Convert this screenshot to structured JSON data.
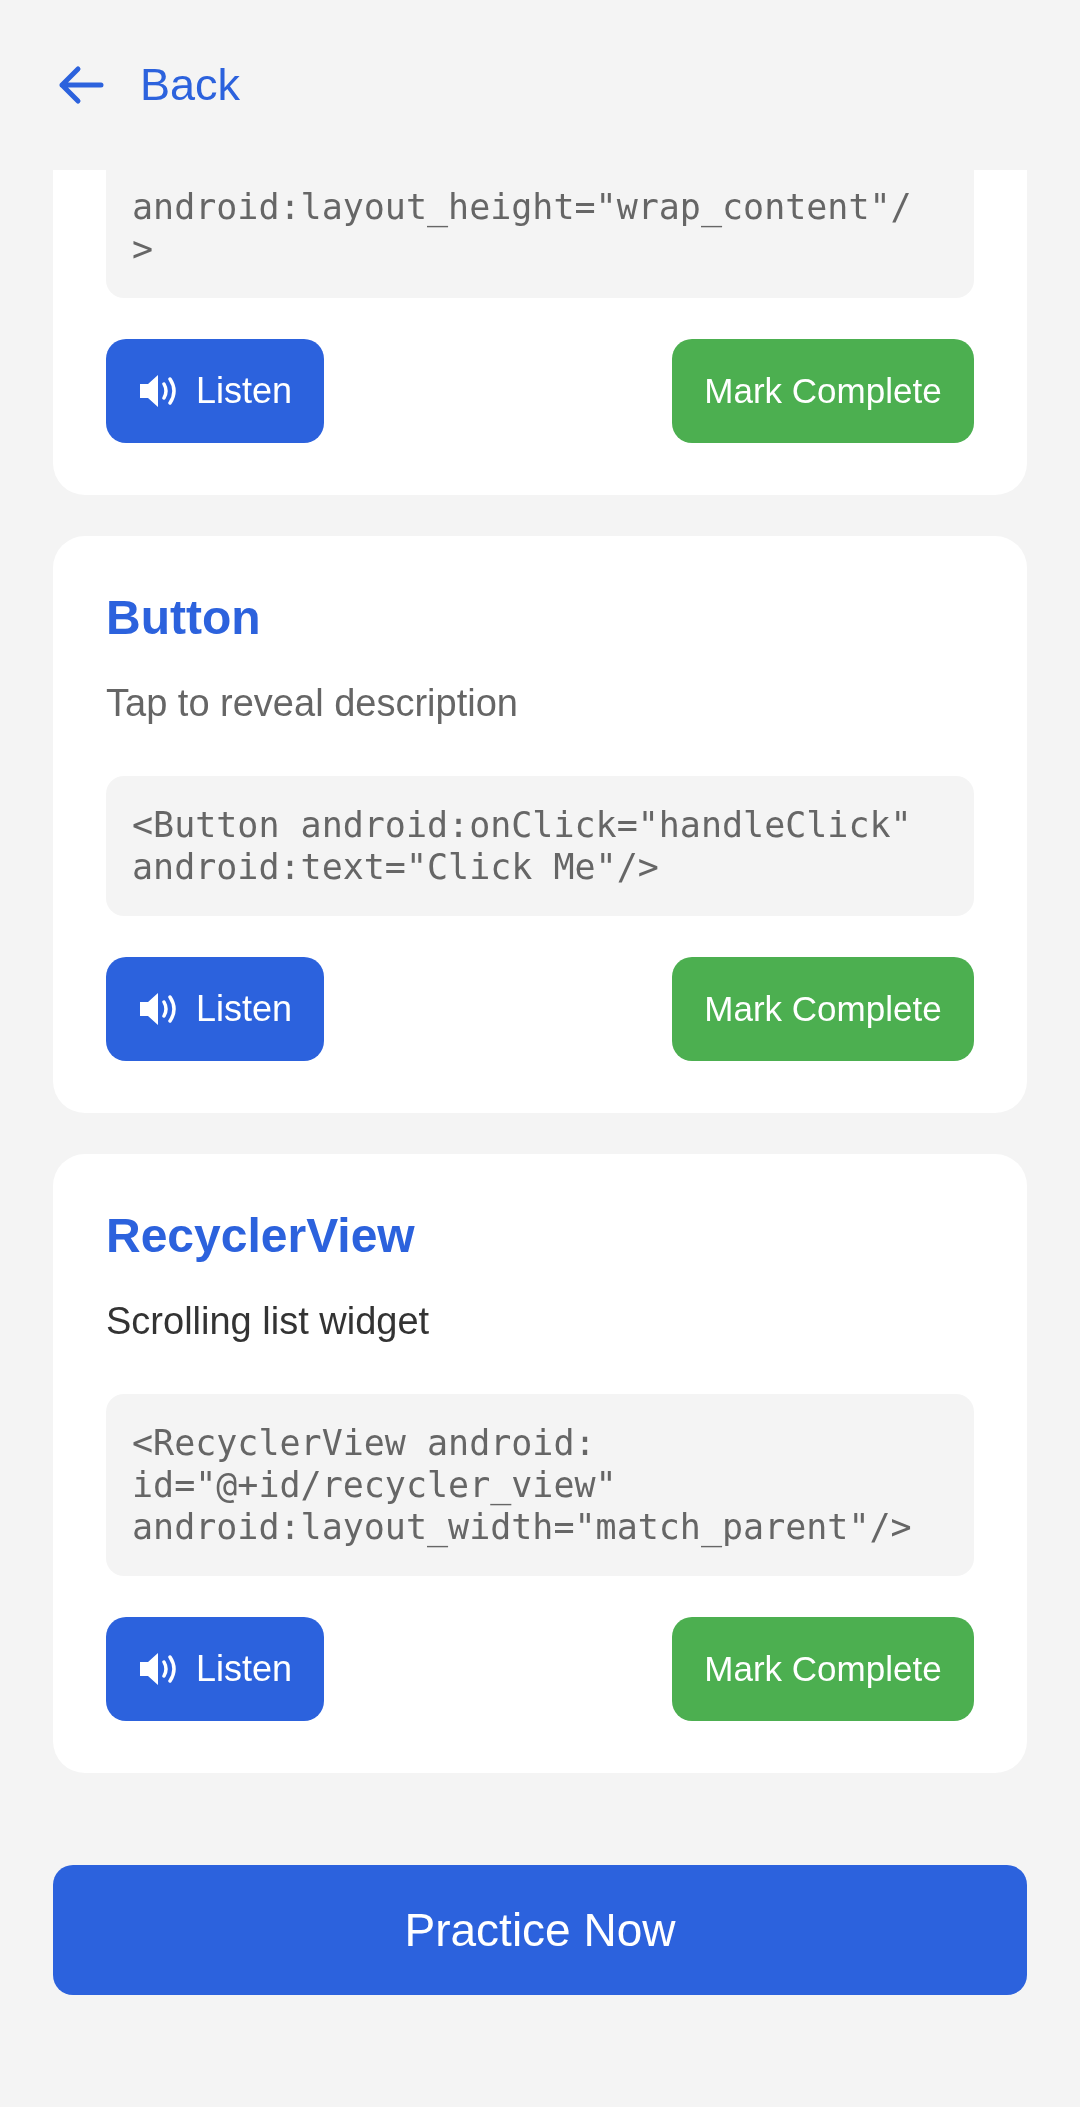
{
  "header": {
    "back_label": "Back"
  },
  "cards": [
    {
      "code": "android:layout_height=\"wrap_content\"/\n>",
      "listen_label": "Listen",
      "complete_label": "Mark Complete"
    },
    {
      "title": "Button",
      "description": "Tap to reveal description",
      "revealed": false,
      "code": "<Button android:onClick=\"handleClick\"\nandroid:text=\"Click Me\"/>",
      "listen_label": "Listen",
      "complete_label": "Mark Complete"
    },
    {
      "title": "RecyclerView",
      "description": "Scrolling list widget",
      "revealed": true,
      "code": "<RecyclerView android:\nid=\"@+id/recycler_view\"\nandroid:layout_width=\"match_parent\"/>",
      "listen_label": "Listen",
      "complete_label": "Mark Complete"
    }
  ],
  "practice_button": "Practice Now"
}
